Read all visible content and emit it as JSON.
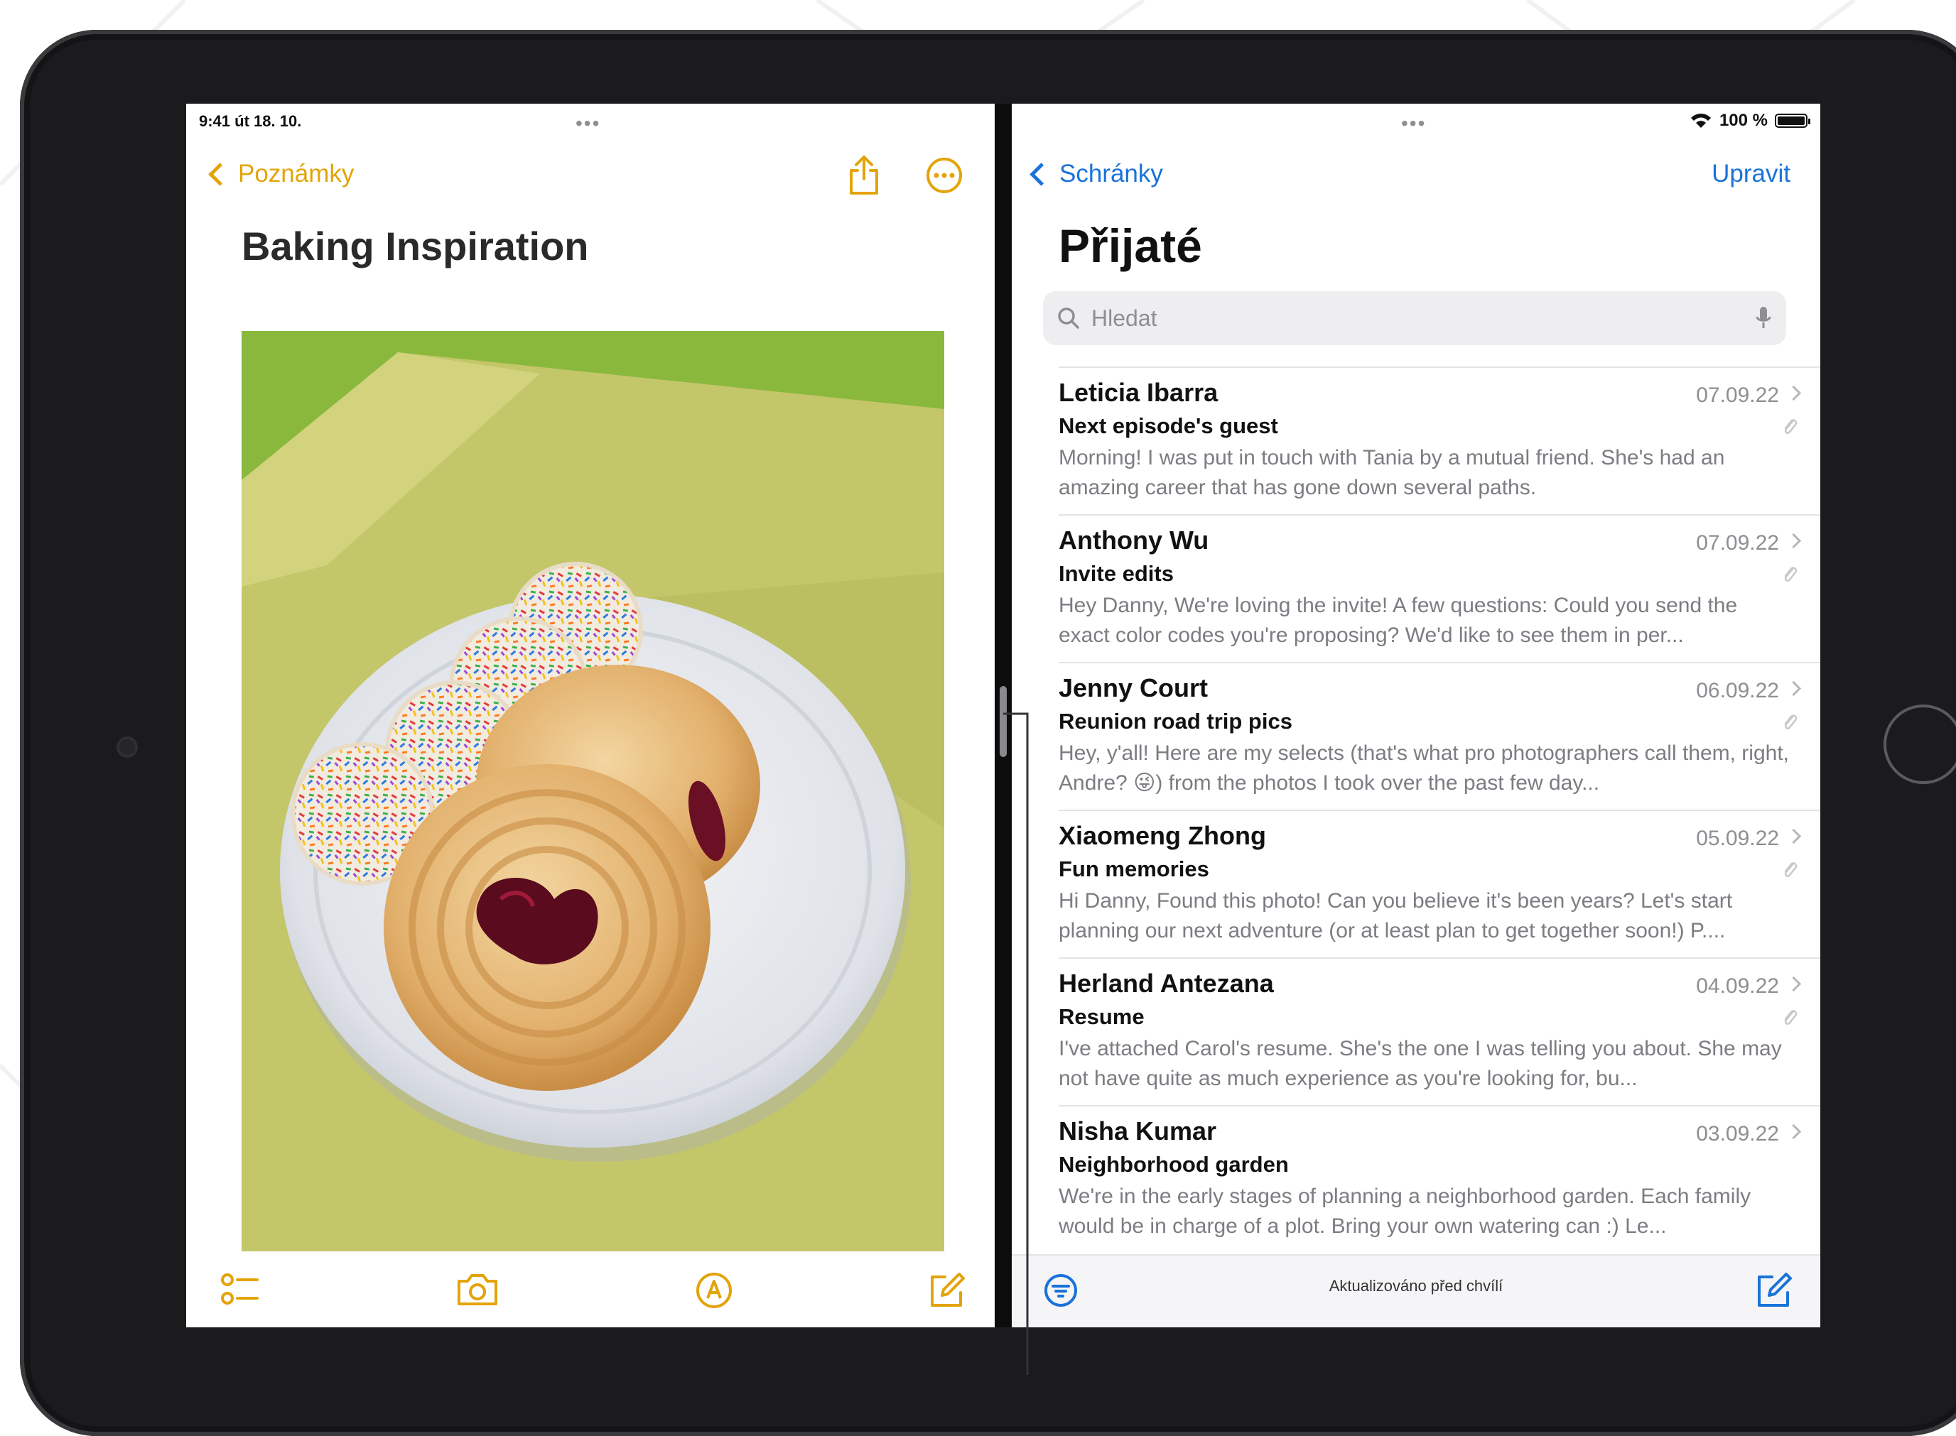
{
  "notes": {
    "status_time": "9:41  út 18. 10.",
    "multitask_dots": "•••",
    "back_label": "Poznámky",
    "title": "Baking Inspiration"
  },
  "mail": {
    "multitask_dots": "•••",
    "battery": "100 %",
    "back_label": "Schránky",
    "edit_label": "Upravit",
    "title": "Přijaté",
    "search_placeholder": "Hledat",
    "messages": [
      {
        "sender": "Leticia Ibarra",
        "date": "07.09.22",
        "subject": "Next episode's guest",
        "preview": "Morning! I was put in touch with Tania by a mutual friend. She's had an amazing career that has gone down several paths."
      },
      {
        "sender": "Anthony Wu",
        "date": "07.09.22",
        "subject": "Invite edits",
        "preview": "Hey Danny, We're loving the invite! A few questions: Could you send the exact color codes you're proposing? We'd like to see them in per..."
      },
      {
        "sender": "Jenny Court",
        "date": "06.09.22",
        "subject": "Reunion road trip pics",
        "preview": "Hey, y'all! Here are my selects (that's what pro photographers call them, right, Andre? 😜) from the photos I took over the past few day..."
      },
      {
        "sender": "Xiaomeng Zhong",
        "date": "05.09.22",
        "subject": "Fun memories",
        "preview": "Hi Danny, Found this photo! Can you believe it's been years? Let's start planning our next adventure (or at least plan to get together soon!) P...."
      },
      {
        "sender": "Herland Antezana",
        "date": "04.09.22",
        "subject": "Resume",
        "preview": "I've attached Carol's resume. She's the one I was telling you about. She may not have quite as much experience as you're looking for, bu..."
      },
      {
        "sender": "Nisha Kumar",
        "date": "03.09.22",
        "subject": "Neighborhood garden",
        "preview": "We're in the early stages of planning a neighborhood garden. Each family would be in charge of a plot. Bring your own watering can :) Le..."
      }
    ],
    "toolbar_status": "Aktualizováno před chvílí"
  },
  "colors": {
    "notes_accent": "#e3a40a",
    "mail_accent": "#1a73d9"
  }
}
